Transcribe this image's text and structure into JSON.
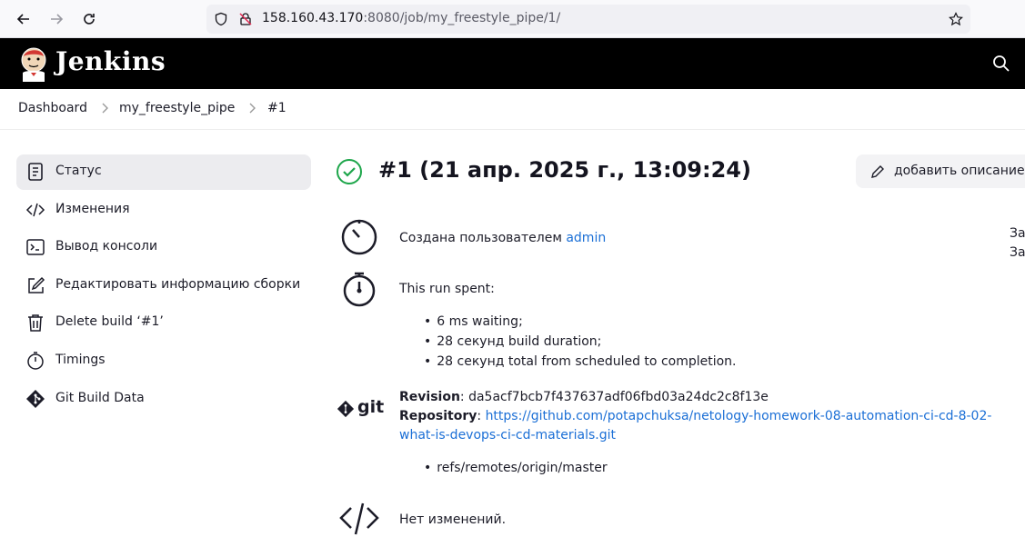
{
  "browser": {
    "url_host": "158.160.43.170",
    "url_rest": ":8080/job/my_freestyle_pipe/1/"
  },
  "header": {
    "title": "Jenkins"
  },
  "breadcrumb": [
    "Dashboard",
    "my_freestyle_pipe",
    "#1"
  ],
  "sidebar": {
    "items": [
      {
        "label": "Статус",
        "icon": "notepad-icon"
      },
      {
        "label": "Изменения",
        "icon": "code-icon"
      },
      {
        "label": "Вывод консоли",
        "icon": "terminal-icon"
      },
      {
        "label": "Редактировать информацию сборки",
        "icon": "edit-icon"
      },
      {
        "label": "Delete build ‘#1’",
        "icon": "trash-icon"
      },
      {
        "label": "Timings",
        "icon": "stopwatch-icon"
      },
      {
        "label": "Git Build Data",
        "icon": "git-icon"
      }
    ]
  },
  "main": {
    "title": "#1 (21 апр. 2025 г., 13:09:24)",
    "add_description": "добавить описание",
    "created_by_prefix": "Создана пользователем",
    "created_by_user": "admin",
    "right_cut_1": "За",
    "right_cut_2": "За",
    "run_spent": "This run spent:",
    "timings": [
      "6 ms waiting;",
      "28 секунд build duration;",
      "28 секунд total from scheduled to completion."
    ],
    "git_logo": "git",
    "revision_label": "Revision",
    "revision_value": ": da5acf7bcb7f437637adf06fbd03a24dc2c8f13e",
    "repository_label": "Repository",
    "repository_sep": ": ",
    "repository_url_line1": "https://github.com/potapchuksa/netology-homework-08-automation-ci-cd-8-02-",
    "repository_url_line2": "what-is-devops-ci-cd-materials.git",
    "ref": "refs/remotes/origin/master",
    "no_changes": "Нет изменений."
  }
}
